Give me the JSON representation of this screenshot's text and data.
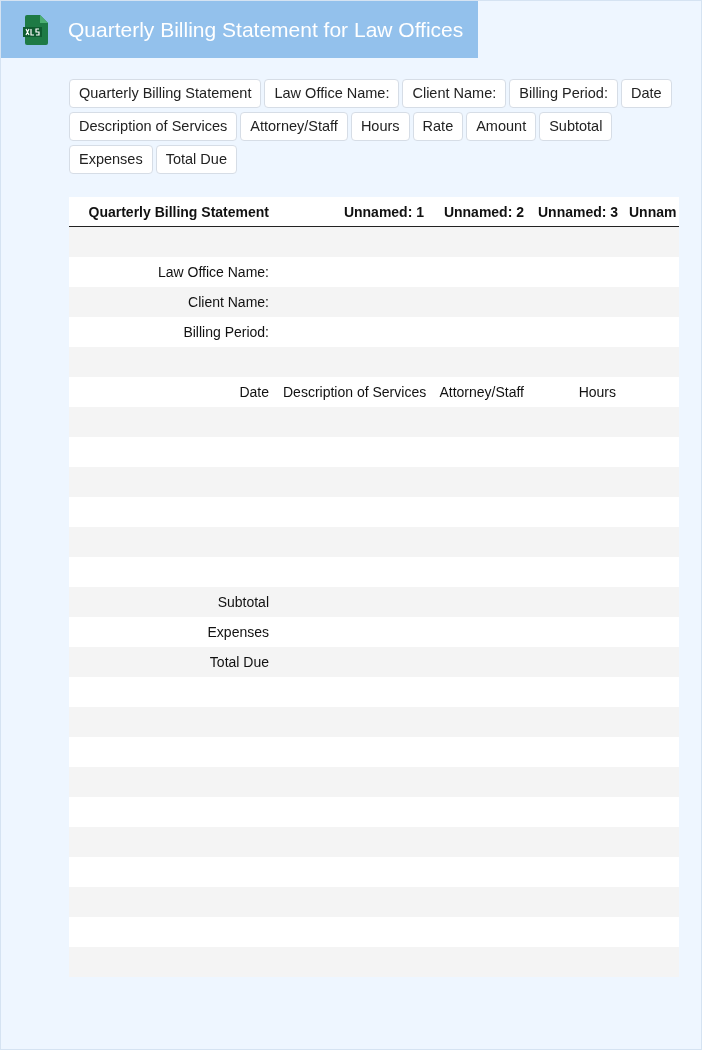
{
  "header": {
    "title": "Quarterly Billing Statement for Law Offices"
  },
  "tags": [
    "Quarterly Billing Statement",
    "Law Office Name:",
    "Client Name:",
    "Billing Period:",
    "Date",
    "Description of Services",
    "Attorney/Staff",
    "Hours",
    "Rate",
    "Amount",
    "Subtotal",
    "Expenses",
    "Total Due"
  ],
  "table": {
    "columns": [
      "Quarterly Billing Statement",
      "Unnamed: 1",
      "Unnamed: 2",
      "Unnamed: 3",
      "Unnam"
    ],
    "rows": [
      {},
      {
        "cells": {
          "0": "Law Office Name:"
        }
      },
      {
        "cells": {
          "0": "Client Name:"
        }
      },
      {
        "cells": {
          "0": "Billing Period:"
        }
      },
      {},
      {
        "cells": {
          "0": "Date",
          "1": "Description of Services",
          "2": "Attorney/Staff",
          "3": "Hours"
        }
      },
      {},
      {},
      {},
      {},
      {},
      {},
      {
        "cells": {
          "0": "Subtotal"
        }
      },
      {
        "cells": {
          "0": "Expenses"
        }
      },
      {
        "cells": {
          "0": "Total Due"
        }
      },
      {},
      {},
      {},
      {},
      {},
      {},
      {},
      {},
      {},
      {}
    ]
  }
}
